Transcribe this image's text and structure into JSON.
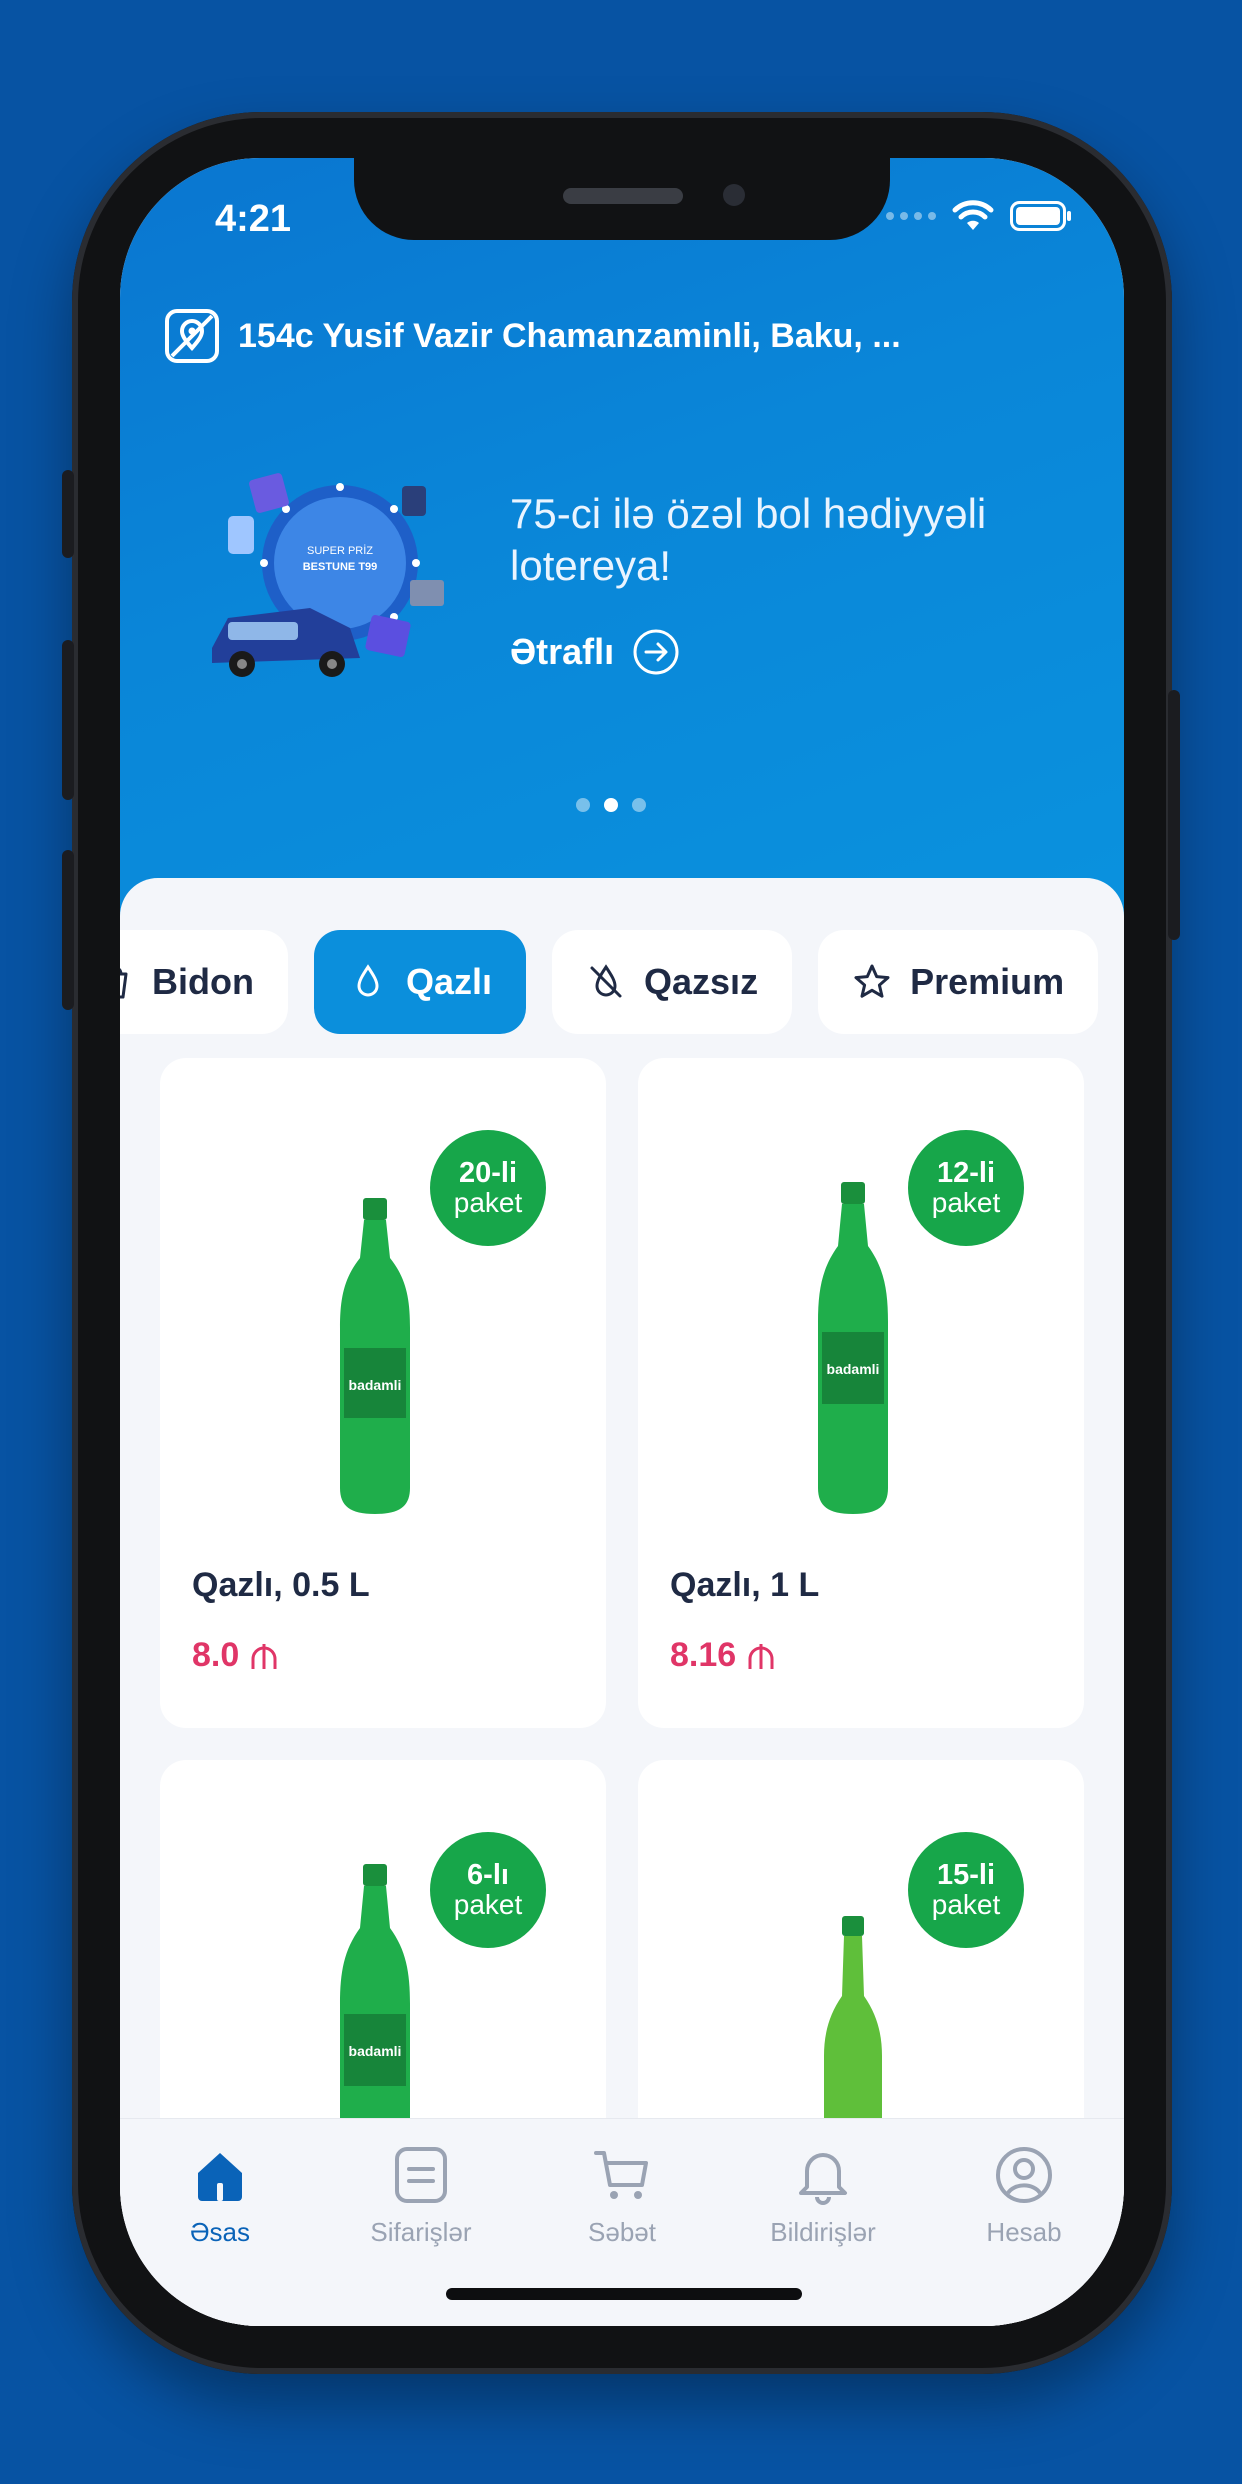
{
  "status": {
    "time": "4:21"
  },
  "address": {
    "text": "154c Yusif Vazir Chamanzaminli, Baku, ..."
  },
  "promo": {
    "title": "75-ci ilə özəl bol hədiyyəli lotereya!",
    "link": "Ətraflı",
    "art_lines": [
      "SUPER PRİZ",
      "BESTUNE T99"
    ],
    "slide_count": 3,
    "active_slide": 2
  },
  "tabs": [
    {
      "label": "Bidon",
      "icon": "bucket-icon"
    },
    {
      "label": "Qazlı",
      "icon": "drop-icon",
      "active": true
    },
    {
      "label": "Qazsız",
      "icon": "no-drop-icon"
    },
    {
      "label": "Premium",
      "icon": "star-icon"
    }
  ],
  "products": [
    {
      "name": "Qazlı, 0.5 L",
      "price": "8.0",
      "badge_top": "20-li",
      "badge_bottom": "paket",
      "brand": "badamli"
    },
    {
      "name": "Qazlı, 1 L",
      "price": "8.16",
      "badge_top": "12-li",
      "badge_bottom": "paket",
      "brand": "badamli"
    },
    {
      "name": "",
      "price": "",
      "badge_top": "6-lı",
      "badge_bottom": "paket",
      "brand": "badamli"
    },
    {
      "name": "",
      "price": "",
      "badge_top": "15-li",
      "badge_bottom": "paket",
      "brand": ""
    }
  ],
  "nav": [
    {
      "label": "Əsas",
      "icon": "home-icon",
      "active": true
    },
    {
      "label": "Sifarişlər",
      "icon": "orders-icon"
    },
    {
      "label": "Səbət",
      "icon": "cart-icon"
    },
    {
      "label": "Bildirişlər",
      "icon": "bell-icon"
    },
    {
      "label": "Hesab",
      "icon": "profile-icon"
    }
  ],
  "colors": {
    "background": "#0753a3",
    "hero": "#0a86d8",
    "accent": "#0b8fdc",
    "badge": "#17a64a",
    "price": "#e03567",
    "nav_active": "#0a63b8"
  }
}
